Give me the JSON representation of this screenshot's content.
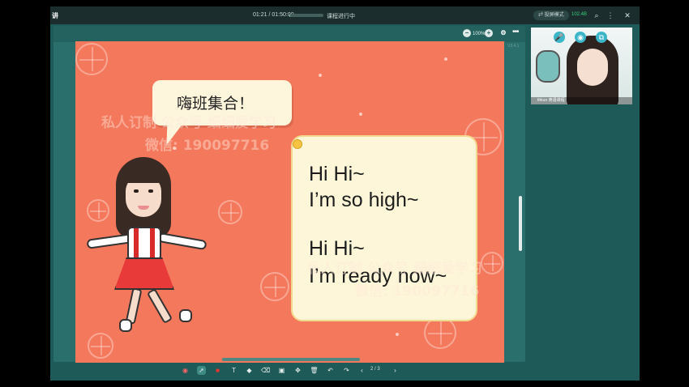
{
  "window": {
    "app_name": "讲",
    "time_display": "01:21 / 01:50:00",
    "class_progress": 0.01,
    "status": "课程进行中",
    "hint_button": "投屏模式",
    "signal": "102.4B"
  },
  "slide_toolbar": {
    "zoom": "100%",
    "more": "•••",
    "version": "V3.4.1"
  },
  "slide": {
    "speech_text": "嗨班集合！",
    "lyrics": [
      "Hi Hi~",
      "I’m so high~",
      "Hi Hi~",
      "I’m ready now~"
    ],
    "watermark_1": "私人订制 公众号 细细爱学习",
    "watermark_2": "微信: 190097716",
    "watermark_3": "私人订制 公众号 细细爱学习",
    "watermark_4": "微信: 190097716"
  },
  "bottom_toolbar": {
    "page_indicator": "2 / 3"
  },
  "video": {
    "name_label": "thkuo 英语课程"
  },
  "colors": {
    "slide_bg": "#f4785c",
    "frame": "#1e5a57",
    "accent_green": "#35d27a"
  }
}
